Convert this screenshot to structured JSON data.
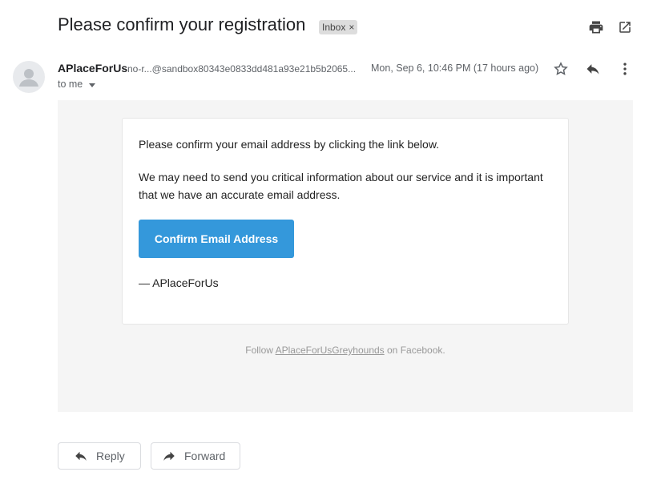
{
  "email": {
    "subject": "Please confirm your registration",
    "label": "Inbox",
    "label_remove": "×",
    "sender_name": "APlaceForUs",
    "sender_email": "no-r...@sandbox80343e0833dd481a93e21b5b2065...",
    "date": "Mon, Sep 6, 10:46 PM (17 hours ago)",
    "recipient": "to me"
  },
  "body": {
    "line1": "Please confirm your email address by clicking the link below.",
    "line2": "We may need to send you critical information about our service and it is important that we have an accurate email address.",
    "button_label": "Confirm Email Address",
    "signature": "— APlaceForUs",
    "footer_prefix": "Follow ",
    "footer_link": "APlaceForUsGreyhounds",
    "footer_suffix": " on Facebook."
  },
  "actions": {
    "reply_label": "Reply",
    "forward_label": "Forward"
  },
  "icons": {
    "print": "print-icon",
    "open_new_window": "open-in-new-window-icon",
    "star": "star-icon",
    "reply": "reply-icon",
    "more": "more-vert-icon",
    "avatar": "person-avatar-icon",
    "forward": "forward-icon"
  },
  "colors": {
    "button": "#3498db",
    "email_background": "#f5f5f5",
    "label_chip": "#dddddd"
  }
}
